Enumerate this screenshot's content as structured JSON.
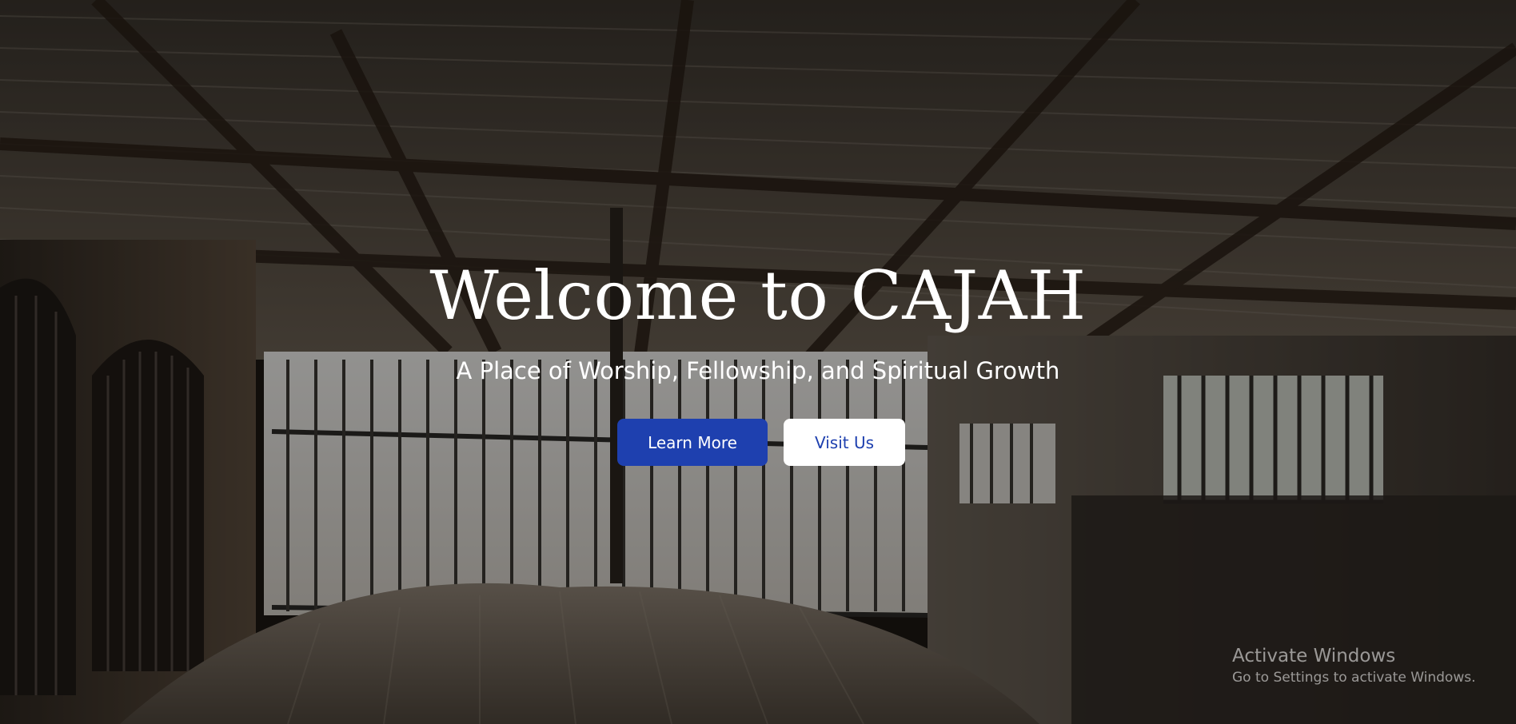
{
  "hero": {
    "title": "Welcome to CAJAH",
    "subtitle": "A Place of Worship, Fellowship, and Spiritual Growth",
    "learn_more_label": "Learn More",
    "visit_us_label": "Visit Us"
  },
  "colors": {
    "primary": "#1e40af",
    "text_light": "#ffffff",
    "background_dark": "#1c1712"
  },
  "os_watermark": {
    "title": "Activate Windows",
    "subtitle": "Go to Settings to activate Windows."
  }
}
